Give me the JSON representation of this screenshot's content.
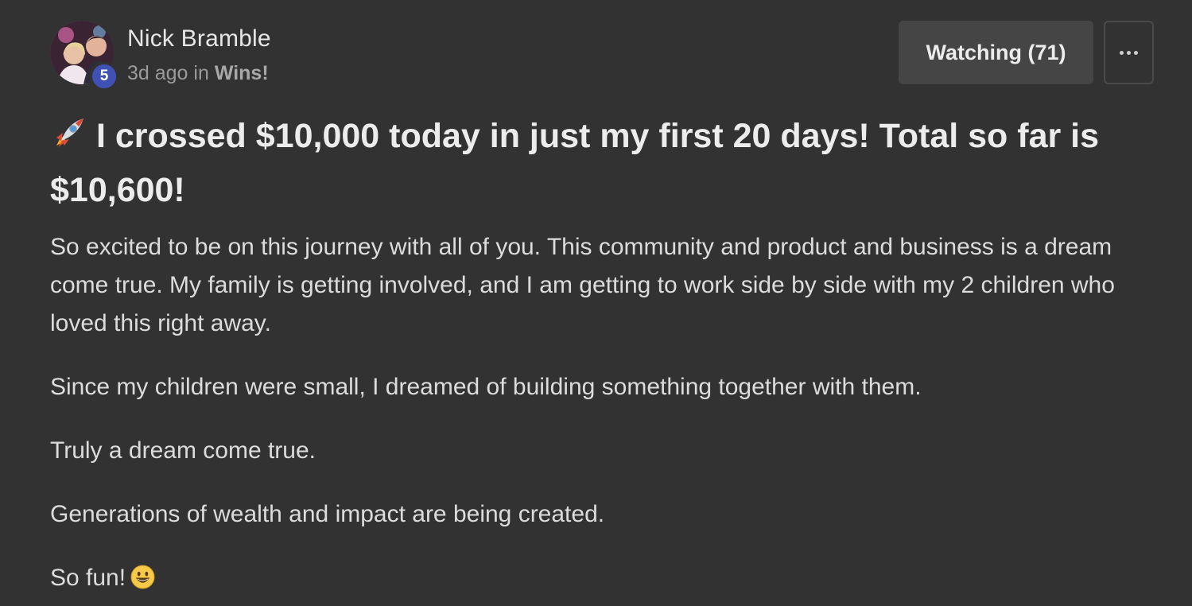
{
  "author": {
    "name": "Nick Bramble",
    "level": "5",
    "avatar_icon": "avatar-photo"
  },
  "meta": {
    "time_ago": "3d ago",
    "in_word": "in",
    "category": "Wins!"
  },
  "actions": {
    "watch_label": "Watching (71)",
    "more_icon": "ellipsis-icon"
  },
  "post": {
    "title_icon": "rocket-icon",
    "title": "I crossed $10,000 today in just my first 20 days! Total so far is $10,600!",
    "paragraphs": [
      "So excited to be on this journey with all of you. This community and product and business is a dream come true. My family is getting involved, and I am getting to work side by side with my 2 children who loved this right away.",
      "Since my children were small, I dreamed of building something together with them.",
      "Truly a dream come true.",
      "Generations of wealth and impact are being created.",
      "So fun!"
    ],
    "last_icon": "smiley-icon"
  },
  "colors": {
    "background": "#323232",
    "badge": "#3f51b5",
    "button": "#454545"
  }
}
